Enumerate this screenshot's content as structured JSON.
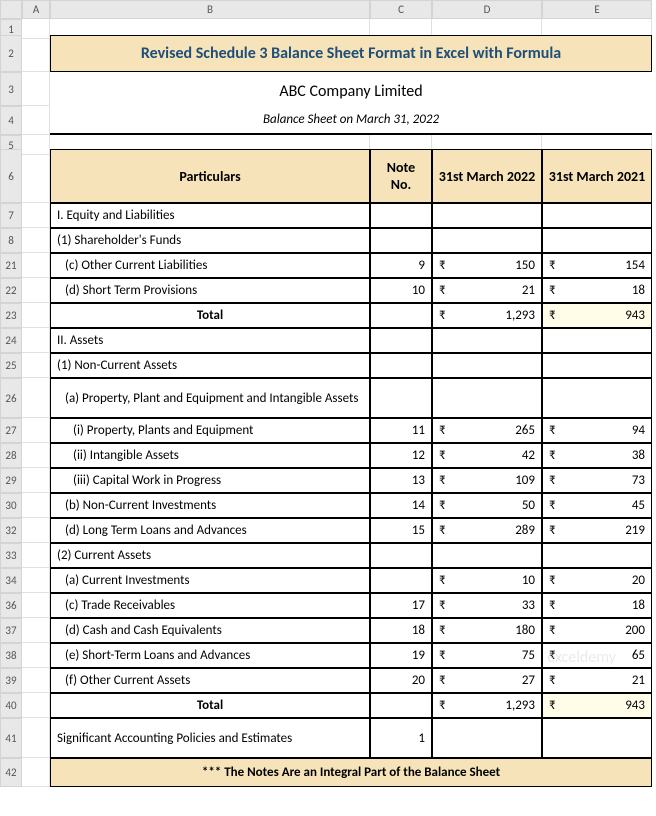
{
  "cols": [
    "",
    "A",
    "B",
    "C",
    "D",
    "E"
  ],
  "title": "Revised Schedule 3 Balance Sheet Format in Excel with Formula",
  "company": "ABC Company Limited",
  "subtitle": "Balance Sheet on March 31, 2022",
  "headers": {
    "particulars": "Particulars",
    "note": "Note No.",
    "y2022": "31st March 2022",
    "y2021": "31st March 2021"
  },
  "rows": [
    {
      "n": "7",
      "p": "I. Equity and Liabilities",
      "note": "",
      "v22": "",
      "v21": "",
      "bold": false
    },
    {
      "n": "8",
      "p": "(1) Shareholder's Funds",
      "note": "",
      "v22": "",
      "v21": "",
      "bold": false
    },
    {
      "n": "21",
      "p": "  (c) Other Current Liabilities",
      "note": "9",
      "v22": "150",
      "v21": "154"
    },
    {
      "n": "22",
      "p": "  (d) Short Term Provisions",
      "note": "10",
      "v22": "21",
      "v21": "18"
    },
    {
      "n": "23",
      "p": "Total",
      "note": "",
      "v22": "1,293",
      "v21": "943",
      "bold": true,
      "hl21": true
    },
    {
      "n": "24",
      "p": "II. Assets",
      "note": "",
      "v22": "",
      "v21": ""
    },
    {
      "n": "25",
      "p": "(1) Non-Current Assets",
      "note": "",
      "v22": "",
      "v21": ""
    },
    {
      "n": "26",
      "p": "  (a) Property, Plant and Equipment and Intangible Assets",
      "note": "",
      "v22": "",
      "v21": "",
      "tall": true
    },
    {
      "n": "27",
      "p": "    (i) Property, Plants and Equipment",
      "note": "11",
      "v22": "265",
      "v21": "94"
    },
    {
      "n": "28",
      "p": "    (ii) Intangible Assets",
      "note": "12",
      "v22": "42",
      "v21": "38"
    },
    {
      "n": "29",
      "p": "    (iii) Capital Work in Progress",
      "note": "13",
      "v22": "109",
      "v21": "73"
    },
    {
      "n": "30",
      "p": "  (b) Non-Current Investments",
      "note": "14",
      "v22": "50",
      "v21": "45"
    },
    {
      "n": "32",
      "p": "  (d) Long Term Loans and Advances",
      "note": "15",
      "v22": "289",
      "v21": "219"
    },
    {
      "n": "33",
      "p": "(2) Current Assets",
      "note": "",
      "v22": "",
      "v21": ""
    },
    {
      "n": "34",
      "p": "  (a) Current Investments",
      "note": "",
      "v22": "10",
      "v21": "20"
    },
    {
      "n": "36",
      "p": "  (c) Trade Receivables",
      "note": "17",
      "v22": "33",
      "v21": "18"
    },
    {
      "n": "37",
      "p": "  (d) Cash and Cash Equivalents",
      "note": "18",
      "v22": "180",
      "v21": "200"
    },
    {
      "n": "38",
      "p": "  (e) Short-Term Loans and Advances",
      "note": "19",
      "v22": "75",
      "v21": "65"
    },
    {
      "n": "39",
      "p": "  (f) Other Current Assets",
      "note": "20",
      "v22": "27",
      "v21": "21"
    },
    {
      "n": "40",
      "p": "Total",
      "note": "",
      "v22": "1,293",
      "v21": "943",
      "bold": true,
      "hl21": true
    },
    {
      "n": "41",
      "p": "Significant Accounting Policies and Estimates",
      "note": "1",
      "v22": "",
      "v21": "",
      "tall": true
    }
  ],
  "footer": "*** The Notes Are an Integral Part of the Balance Sheet",
  "rupee": "₹",
  "watermark": "exceldemy"
}
